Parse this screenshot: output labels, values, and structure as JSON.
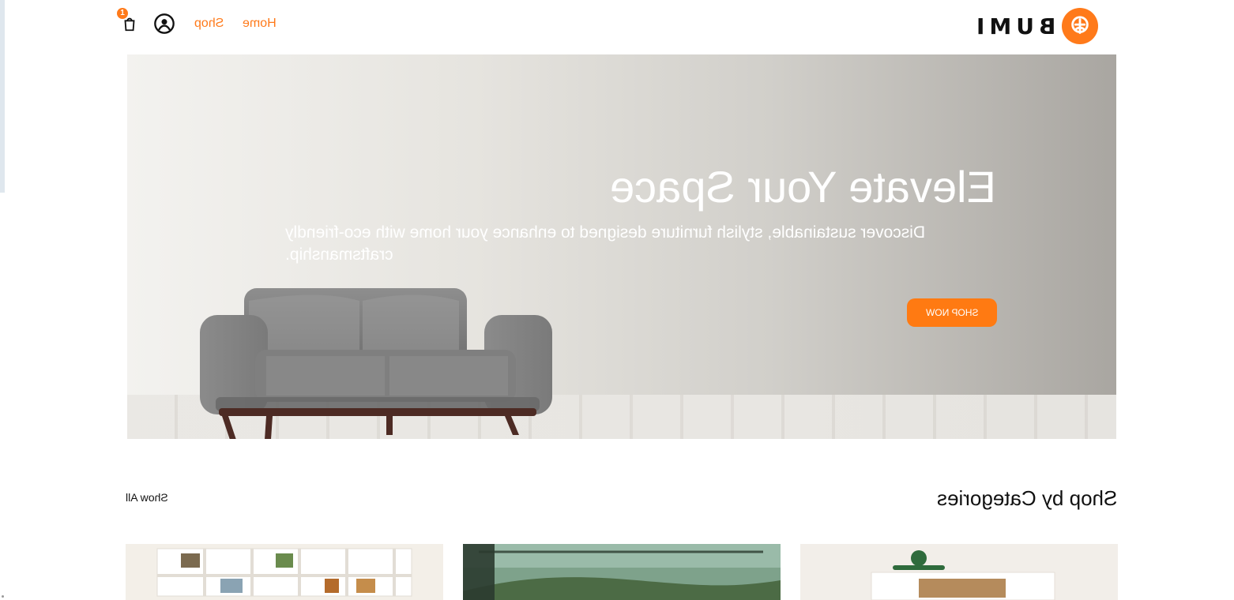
{
  "header": {
    "brand": "BUMI",
    "nav": {
      "cart_count": "1",
      "home_label": "Home",
      "shop_label": "Shop"
    }
  },
  "hero": {
    "title": "Elevate Your Space",
    "subtitle": "Discover sustainable, stylish furniture designed to enhance your home with eco-friendly craftsmanship.",
    "cta_label": "SHOP NOW"
  },
  "categories": {
    "title": "Shop by Categories",
    "show_all_label": "Show All"
  },
  "colors": {
    "accent": "#ff7a1a",
    "text": "#111111",
    "hero_text": "#ffffff"
  },
  "icons": [
    "logo-mark-icon",
    "cart-icon",
    "user-icon"
  ]
}
